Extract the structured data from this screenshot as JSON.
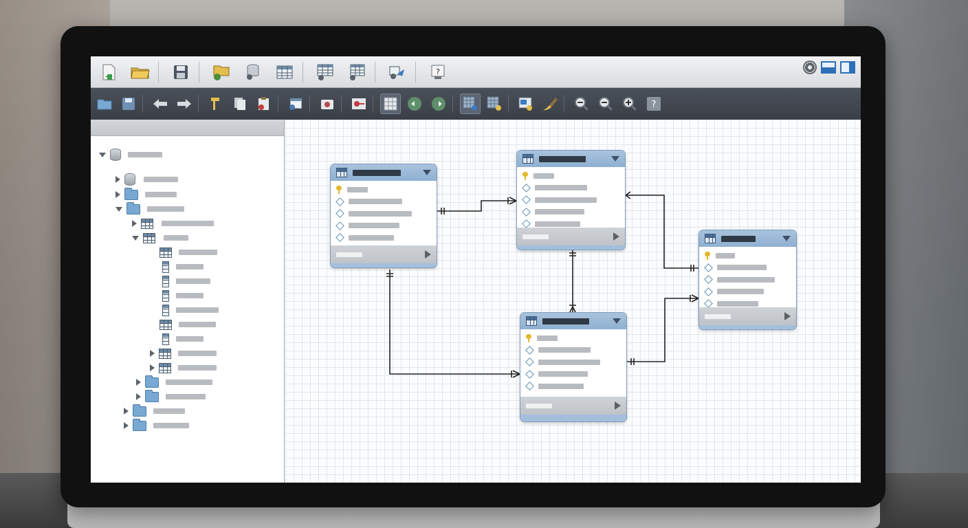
{
  "app": {
    "title": ""
  },
  "toolbar_primary": {
    "items": [
      {
        "icon": "new-model-icon"
      },
      {
        "icon": "open-folder-icon"
      },
      {
        "icon": "save-icon"
      },
      {
        "icon": "open-recent-icon"
      },
      {
        "icon": "database-settings-icon"
      },
      {
        "icon": "table-tool-icon"
      },
      {
        "icon": "table-edit-icon"
      },
      {
        "icon": "relationship-tool-icon"
      },
      {
        "icon": "routine-icon"
      },
      {
        "icon": "help-icon"
      }
    ],
    "help_label": "?"
  },
  "toolbar_right": {
    "settings_icon": "gear-icon",
    "layout_icons": [
      "layout-horizontal-icon",
      "layout-vertical-icon"
    ]
  },
  "toolbar_secondary": {
    "items": [
      {
        "icon": "folder-icon"
      },
      {
        "icon": "save-as-icon"
      },
      {
        "icon": "back-arrow-icon"
      },
      {
        "icon": "forward-arrow-icon"
      },
      {
        "icon": "cut-icon"
      },
      {
        "icon": "copy-icon"
      },
      {
        "icon": "paste-icon"
      },
      {
        "icon": "table-import-icon"
      },
      {
        "icon": "snapshot-icon"
      },
      {
        "icon": "key-icon"
      },
      {
        "icon": "grid-icon"
      },
      {
        "icon": "go-back-icon"
      },
      {
        "icon": "go-forward-icon"
      },
      {
        "icon": "grid-select-icon"
      },
      {
        "icon": "grid-settings-icon"
      },
      {
        "icon": "export-image-icon"
      },
      {
        "icon": "brush-icon"
      },
      {
        "icon": "zoom-out-icon"
      },
      {
        "icon": "zoom-reset-icon"
      },
      {
        "icon": "zoom-in-icon"
      },
      {
        "icon": "help-icon"
      }
    ],
    "help_label": "?"
  },
  "colors": {
    "accent_blue": "#8fb0d1",
    "toolbar_dark": "#3a3f47",
    "key_gold": "#e3b72a",
    "connector": "#222222"
  }
}
